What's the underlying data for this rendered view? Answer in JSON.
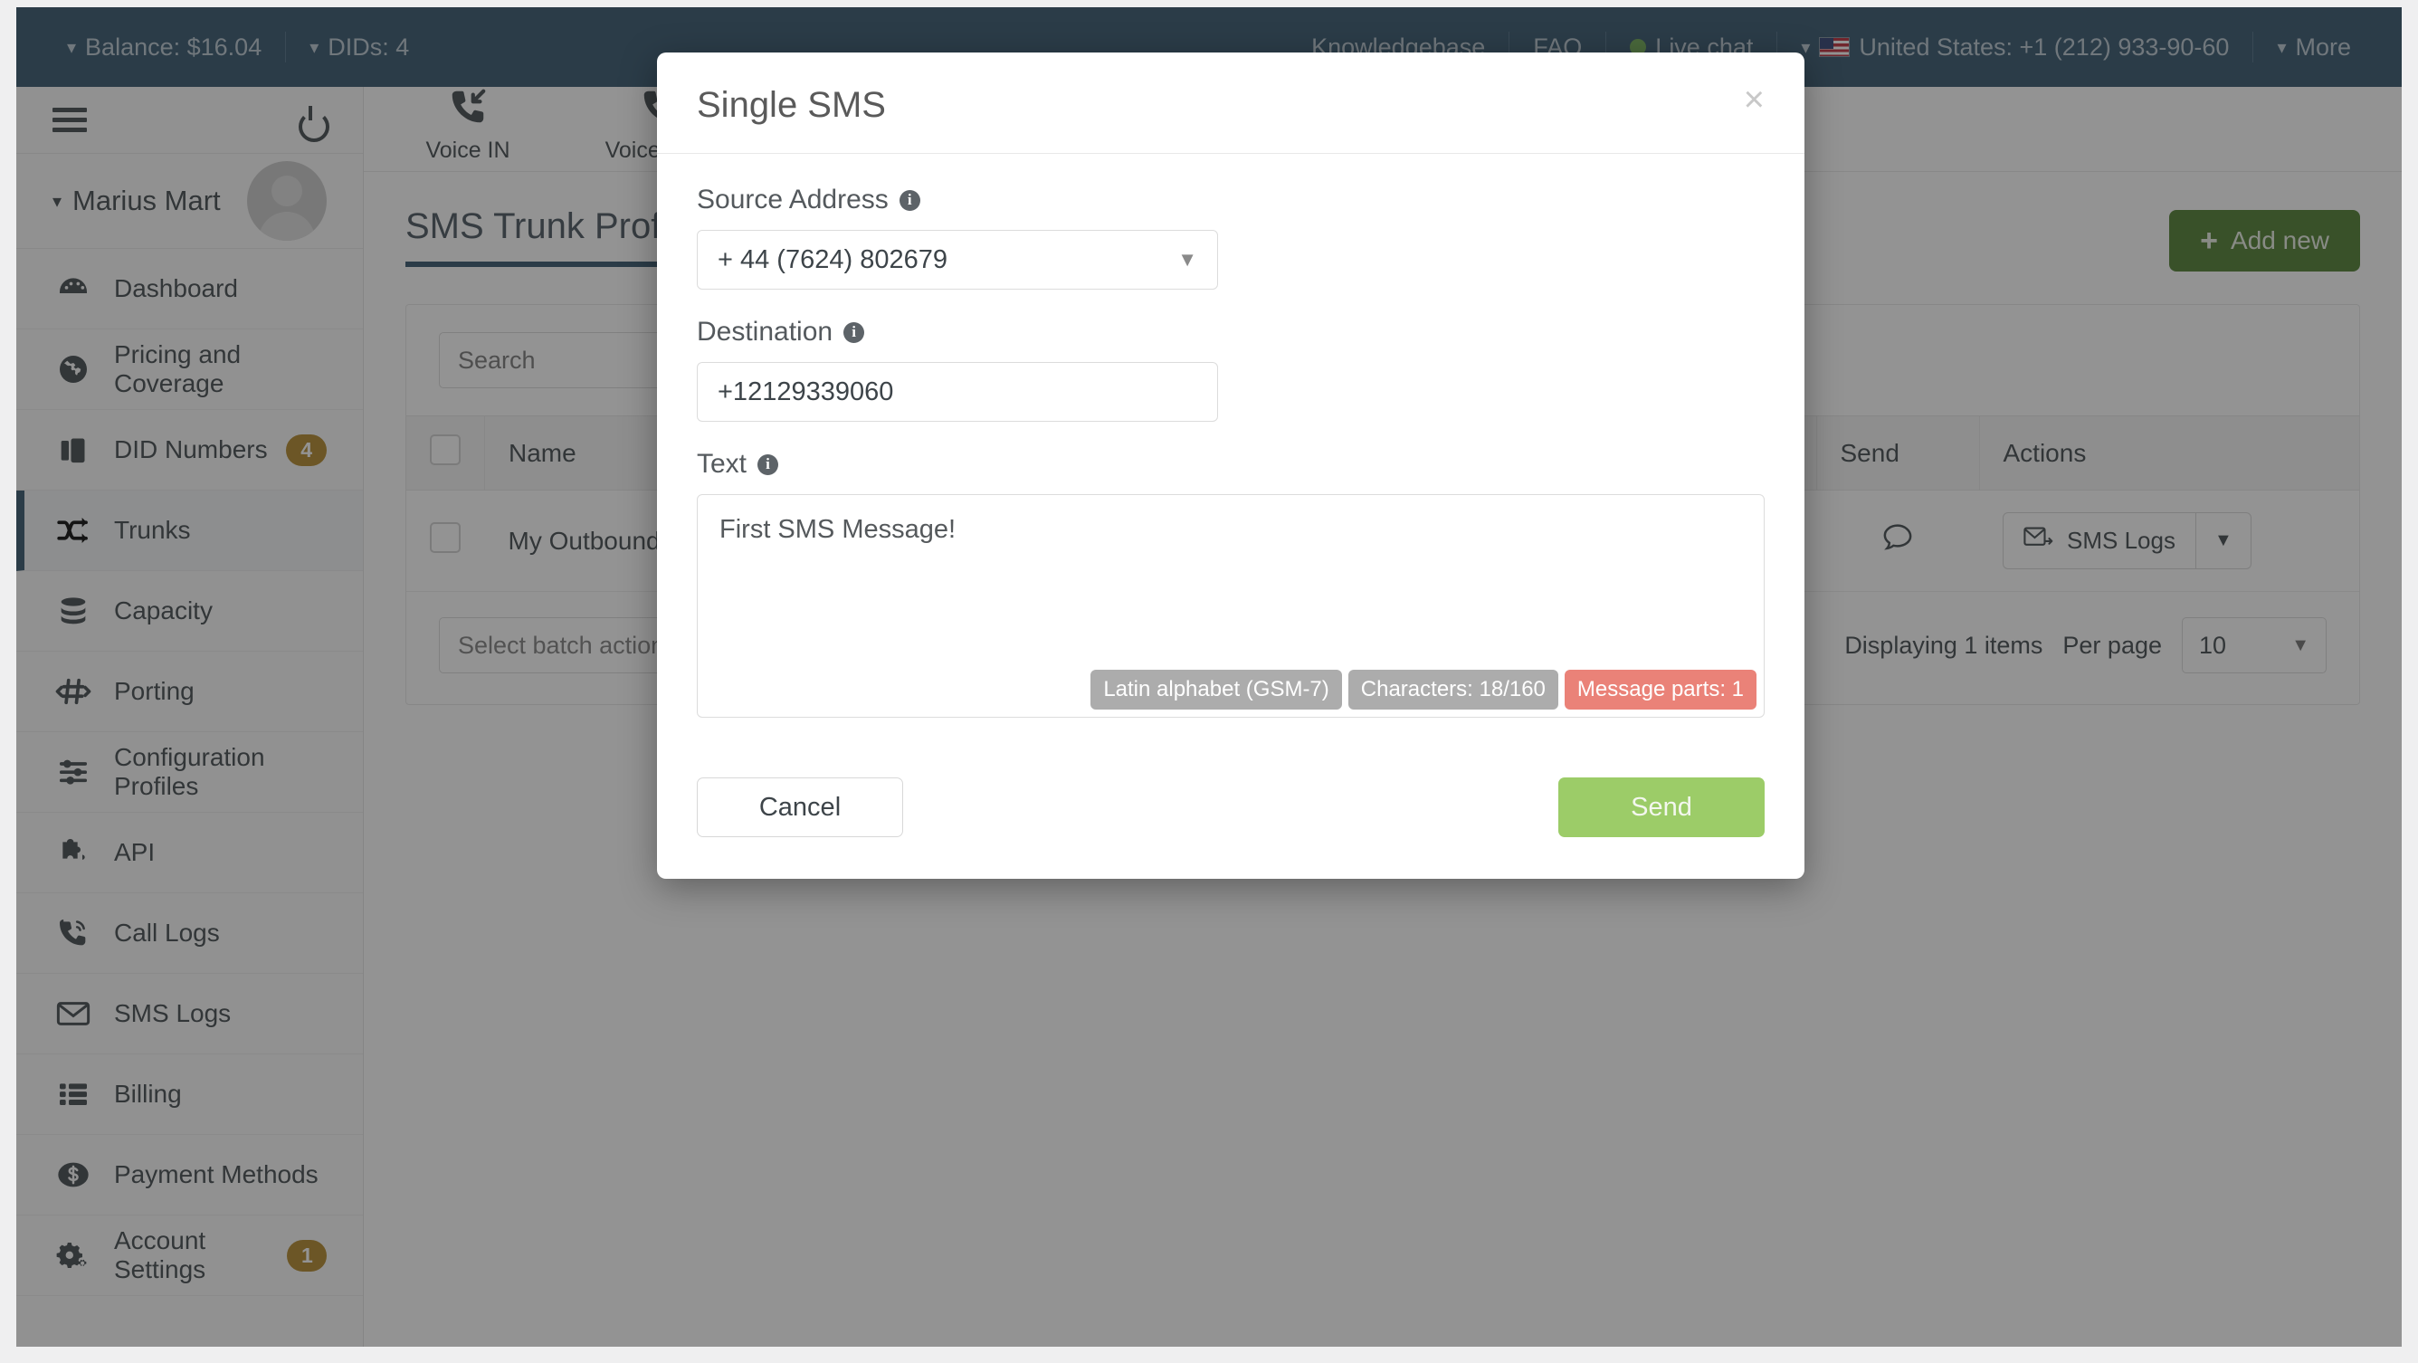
{
  "topbar": {
    "balance": "Balance: $16.04",
    "dids": "DIDs: 4",
    "knowledgebase": "Knowledgebase",
    "faq": "FAQ",
    "live_chat": "Live chat",
    "country_phone": "United States: +1 (212) 933-90-60",
    "more": "More",
    "bg_color": "#2e5169"
  },
  "sidebar": {
    "user_name": "Marius Mart",
    "items": [
      {
        "label": "Dashboard",
        "icon": "gauge-icon",
        "badge": null,
        "active": false
      },
      {
        "label": "Pricing and Coverage",
        "icon": "globe-icon",
        "badge": null,
        "active": false
      },
      {
        "label": "DID Numbers",
        "icon": "briefcase-icon",
        "badge": "4",
        "active": false
      },
      {
        "label": "Trunks",
        "icon": "shuffle-icon",
        "badge": null,
        "active": true
      },
      {
        "label": "Capacity",
        "icon": "database-icon",
        "badge": null,
        "active": false
      },
      {
        "label": "Porting",
        "icon": "hash-arrows-icon",
        "badge": null,
        "active": false
      },
      {
        "label": "Configuration Profiles",
        "icon": "sliders-icon",
        "badge": null,
        "active": false
      },
      {
        "label": "API",
        "icon": "puzzle-icon",
        "badge": null,
        "active": false
      },
      {
        "label": "Call Logs",
        "icon": "phone-icon",
        "badge": null,
        "active": false
      },
      {
        "label": "SMS Logs",
        "icon": "envelope-icon",
        "badge": null,
        "active": false
      },
      {
        "label": "Billing",
        "icon": "list-icon",
        "badge": null,
        "active": false
      },
      {
        "label": "Payment Methods",
        "icon": "dollar-circle-icon",
        "badge": null,
        "active": false
      },
      {
        "label": "Account Settings",
        "icon": "gears-icon",
        "badge": "1",
        "active": false
      }
    ],
    "badge_color": "#b08524",
    "active_accent": "#2e5169"
  },
  "toolbar": {
    "items": [
      {
        "label": "Voice IN",
        "icon": "phone-incoming-icon"
      },
      {
        "label": "Voice OUT",
        "icon": "phone-outgoing-icon"
      }
    ]
  },
  "page": {
    "title": "SMS Trunk Profile",
    "add_new_label": "Add new",
    "add_new_color": "#4b7a2b"
  },
  "table": {
    "search_placeholder": "Search",
    "columns": [
      "",
      "Name",
      "Send",
      "Actions"
    ],
    "rows": [
      {
        "name": "My Outbound",
        "send_icon": "speech-bubble-icon",
        "action_label": "SMS Logs",
        "action_icon": "envelope-out-icon"
      }
    ],
    "batch_action_label": "Select batch action",
    "displaying_text": "Displaying 1 items",
    "per_page_label": "Per page",
    "per_page_value": "10"
  },
  "modal": {
    "title": "Single SMS",
    "close_label": "×",
    "source_label": "Source Address",
    "source_value": "+ 44 (7624) 802679",
    "destination_label": "Destination",
    "destination_value": "+12129339060",
    "text_label": "Text",
    "text_value": "First SMS Message!",
    "badges": [
      {
        "label": "Latin alphabet (GSM-7)",
        "color": "#acacac"
      },
      {
        "label": "Characters: 18/160",
        "color": "#acacac"
      },
      {
        "label": "Message parts: 1",
        "color": "#ea8278"
      }
    ],
    "cancel_label": "Cancel",
    "send_label": "Send",
    "send_color": "#9ccc68"
  }
}
